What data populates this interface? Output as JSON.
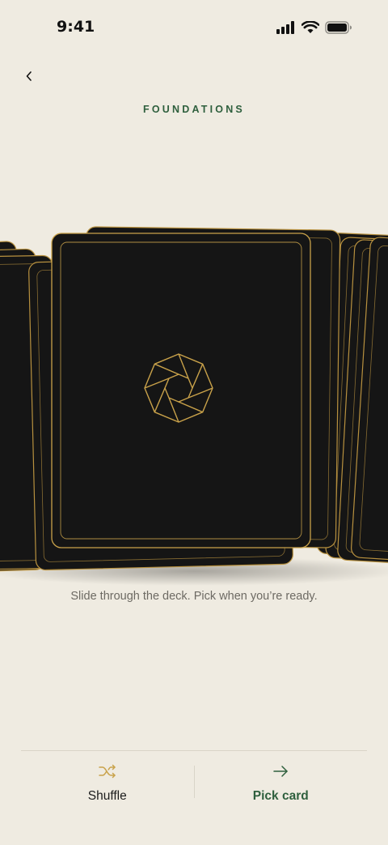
{
  "status_bar": {
    "time": "9:41",
    "icons": [
      "signal-icon",
      "wifi-icon",
      "battery-icon"
    ]
  },
  "header": {
    "back_icon": "chevron-left-icon",
    "title": "FOUNDATIONS"
  },
  "deck": {
    "card_back_emblem": "octagon-gem-icon",
    "card_color": "#151515",
    "accent_color": "#c9a24a"
  },
  "hint": "Slide through the deck. Pick when you’re ready.",
  "actions": {
    "shuffle": {
      "label": "Shuffle",
      "icon": "shuffle-icon",
      "color": "#c9a24a"
    },
    "pick": {
      "label": "Pick card",
      "icon": "arrow-right-icon",
      "color": "#2e5f3d"
    }
  },
  "colors": {
    "background": "#efebe1",
    "brand_green": "#2e5f3d",
    "gold": "#c9a24a"
  }
}
